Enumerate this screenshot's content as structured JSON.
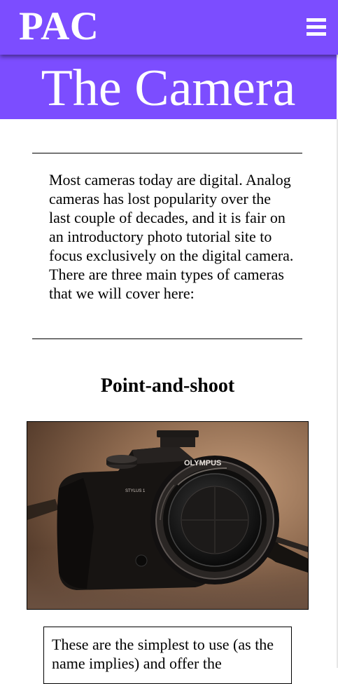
{
  "header": {
    "brand": "PAC",
    "menu_icon": "hamburger-menu-icon",
    "background_color": "#7c4dff"
  },
  "page": {
    "title": "The Camera",
    "intro": "Most cameras today are digital. Analog cameras has lost popularity over the last couple of decades, and it is fair on an introductory photo tutorial site to focus exclusively on the digital camera. There are three main types of cameras that we will cover here:"
  },
  "sections": [
    {
      "heading": "Point-and-shoot",
      "image_logo_text": "OLYMPUS",
      "image_model_text": "STYLUS 1",
      "description": "These are the simplest to use (as the name implies) and offer the"
    }
  ]
}
